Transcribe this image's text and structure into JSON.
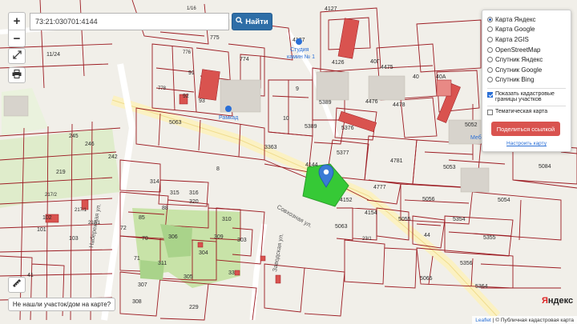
{
  "search": {
    "value": "73:21:030701:4144",
    "button_label": "Найти"
  },
  "zoom": {
    "in_label": "+",
    "out_label": "−"
  },
  "layers": {
    "options": [
      {
        "label": "Карта Яндекс",
        "selected": true
      },
      {
        "label": "Карта Google",
        "selected": false
      },
      {
        "label": "Карта 2GIS",
        "selected": false
      },
      {
        "label": "OpenStreetMap",
        "selected": false
      },
      {
        "label": "Спутник Яндекс",
        "selected": false
      },
      {
        "label": "Спутник Google",
        "selected": false
      },
      {
        "label": "Спутник Bing",
        "selected": false
      }
    ],
    "show_cadastral_label": "Показать кадастровые границы участков",
    "show_cadastral_checked": true,
    "thematic_label": "Тематическая карта",
    "thematic_checked": false,
    "share_button": "Поделиться ссылкой",
    "configure_link": "Настроить карту"
  },
  "not_found_button": "Не нашли участок/дом на карте?",
  "attribution": {
    "leaflet": "Leaflet",
    "source": "| © Публичная кадастровая карта"
  },
  "yandex_logo": {
    "prefix": "Я",
    "rest": "ндекс"
  },
  "poi": {
    "studio": "Студия",
    "kamin": "камин № 1",
    "ramkad": "Рамкад",
    "meb": "Меб"
  },
  "streets": {
    "sovkhoznaya": "Совхозная ул.",
    "naberezhnaya": "Набережная ул.",
    "zavodskaya": "Заводская ул."
  },
  "parcel_labels": [
    "4127",
    "4127",
    "1/16",
    "11/24",
    "775",
    "776",
    "774",
    "91",
    "92",
    "93",
    "778",
    "5063",
    "5389",
    "9",
    "10",
    "5389",
    "3363",
    "5376",
    "5377",
    "4144",
    "4152",
    "4154",
    "4777",
    "4781",
    "4475",
    "4476",
    "4478",
    "5052",
    "5053",
    "5056",
    "5084",
    "5054",
    "5055",
    "5063",
    "5354",
    "5355",
    "5356",
    "5065",
    "5364",
    "44",
    "4126",
    "40Г",
    "40",
    "40А",
    "8",
    "245",
    "246",
    "242",
    "219",
    "217/2",
    "217/1",
    "218/1",
    "102",
    "101",
    "103",
    "314",
    "315",
    "316",
    "320",
    "85",
    "88",
    "70",
    "72",
    "306",
    "71",
    "309",
    "303",
    "311",
    "304",
    "307",
    "310",
    "305",
    "41",
    "33",
    "308",
    "229",
    "23/1"
  ],
  "colors": {
    "boundary": "#9c1b22",
    "selected_fill": "#36c936",
    "building": "#d9534f",
    "pin": "#3a7bd5",
    "green_area": "#c8e3a8",
    "road": "#fff3b8"
  }
}
